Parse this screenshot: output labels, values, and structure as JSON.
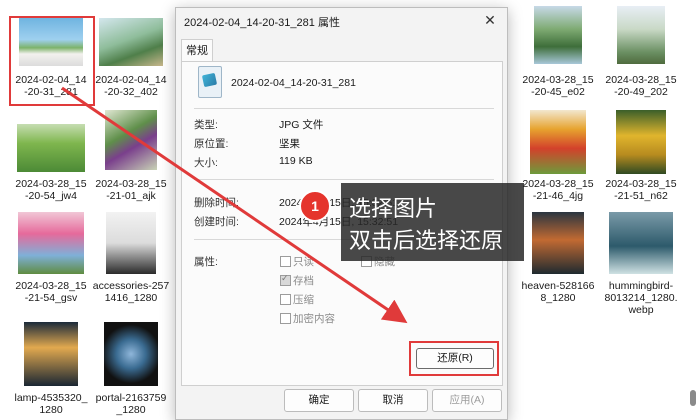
{
  "files": [
    {
      "name": "2024-02-04_14\n-20-31_281"
    },
    {
      "name": "2024-02-04_14\n-20-32_402"
    },
    {
      "name": "2024-03-28_15\n-20-45_e02"
    },
    {
      "name": "2024-03-28_15\n-20-49_202"
    },
    {
      "name": "2024-03-28_15\n-20-54_jw4"
    },
    {
      "name": "2024-03-28_15\n-21-01_ajk"
    },
    {
      "name": "2024-03-28_15\n-21-46_4jg"
    },
    {
      "name": "2024-03-28_15\n-21-51_n62"
    },
    {
      "name": "2024-03-28_15\n-21-54_gsv"
    },
    {
      "name": "accessories-257\n1416_1280"
    },
    {
      "name": "heaven-528166\n8_1280"
    },
    {
      "name": "hummingbird-\n8013214_1280.\nwebp"
    },
    {
      "name": "lamp-4535320_\n1280"
    },
    {
      "name": "portal-2163759\n_1280"
    }
  ],
  "dialog": {
    "title": "2024-02-04_14-20-31_281 属性",
    "close_icon": "close-icon",
    "tab": "常规",
    "file_name": "2024-02-04_14-20-31_281",
    "type_label": "类型:",
    "type_value": "JPG 文件",
    "location_label": "原位置:",
    "location_value": "坚果",
    "size_label": "大小:",
    "size_value": "119 KB",
    "deleted_label": "删除时间:",
    "deleted_value": "2024年4月15日, 15:32:51",
    "created_label": "创建时间:",
    "created_value": "2024年4月15日, 15:32:51",
    "attrs_label": "属性:",
    "attrs": {
      "readonly": "只读",
      "hidden": "隐藏",
      "archive": "存档",
      "compress": "压缩",
      "encrypt": "加密内容"
    },
    "restore_button": "还原(R)",
    "ok_button": "确定",
    "cancel_button": "取消",
    "apply_button": "应用(A)"
  },
  "tutorial": {
    "step": "1",
    "line1": "选择图片",
    "line2": "双击后选择还原"
  },
  "colors": {
    "highlight": "#e03a3a",
    "badge": "#e5342c"
  }
}
